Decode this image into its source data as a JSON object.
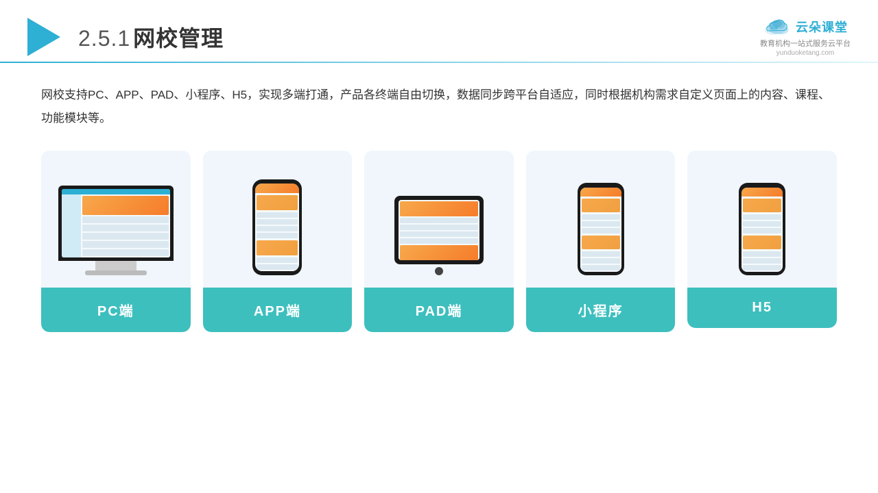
{
  "header": {
    "title_num": "2.5.1",
    "title_text": "网校管理",
    "brand_name": "云朵课堂",
    "brand_tagline": "教育机构一站\n式服务云平台",
    "brand_url": "yunduoketang.com"
  },
  "content": {
    "description": "网校支持PC、APP、PAD、小程序、H5，实现多端打通，产品各终端自由切换，数据同步跨平台自适应，同时根据机构需求自定义页面上的内容、课程、功能模块等。"
  },
  "cards": [
    {
      "id": "pc",
      "label": "PC端"
    },
    {
      "id": "app",
      "label": "APP端"
    },
    {
      "id": "pad",
      "label": "PAD端"
    },
    {
      "id": "miniapp",
      "label": "小程序"
    },
    {
      "id": "h5",
      "label": "H5"
    }
  ]
}
